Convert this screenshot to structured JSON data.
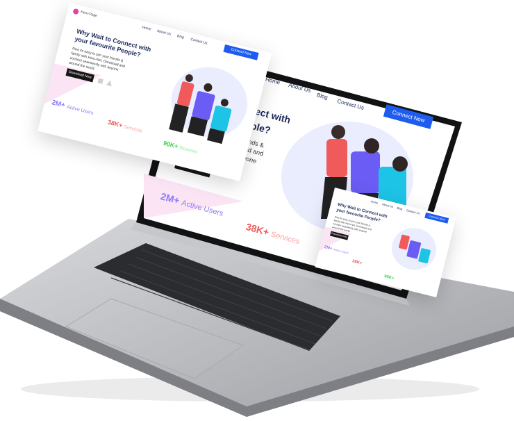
{
  "site": {
    "logo_text": "Hero-Page",
    "nav": [
      "Home",
      "About Us",
      "Blog",
      "Contact Us"
    ],
    "cta": "Connect Now",
    "headline": "Why Wait to Connect with your favourite People?",
    "headline_line1": "Why Wait to Connect with",
    "headline_line2": "your favourite People?",
    "body": [
      "Now its easy to join your friends &",
      "family with Hero-Net. Download and",
      "connect seamlessly with anyone",
      "around the world."
    ],
    "download": "Download Now",
    "stats": {
      "users_num": "2M+",
      "users_label": "Active Users",
      "services_num": "38K+",
      "services_label": "Services",
      "reviews_num": "90K+",
      "reviews_label": "Reviews"
    },
    "large_screen": {
      "headline_line1": "nnect with",
      "headline_line2": "eople?",
      "body": [
        "friends &",
        "load and",
        "nyone"
      ]
    }
  },
  "colors": {
    "brand_blue": "#1e5cf0",
    "navy": "#1c2a5a",
    "users": "#8a7cf5",
    "services": "#f05a5a",
    "reviews": "#39d64a",
    "blob": "#e9edfd",
    "pink_tri": "#fbe4f3"
  }
}
